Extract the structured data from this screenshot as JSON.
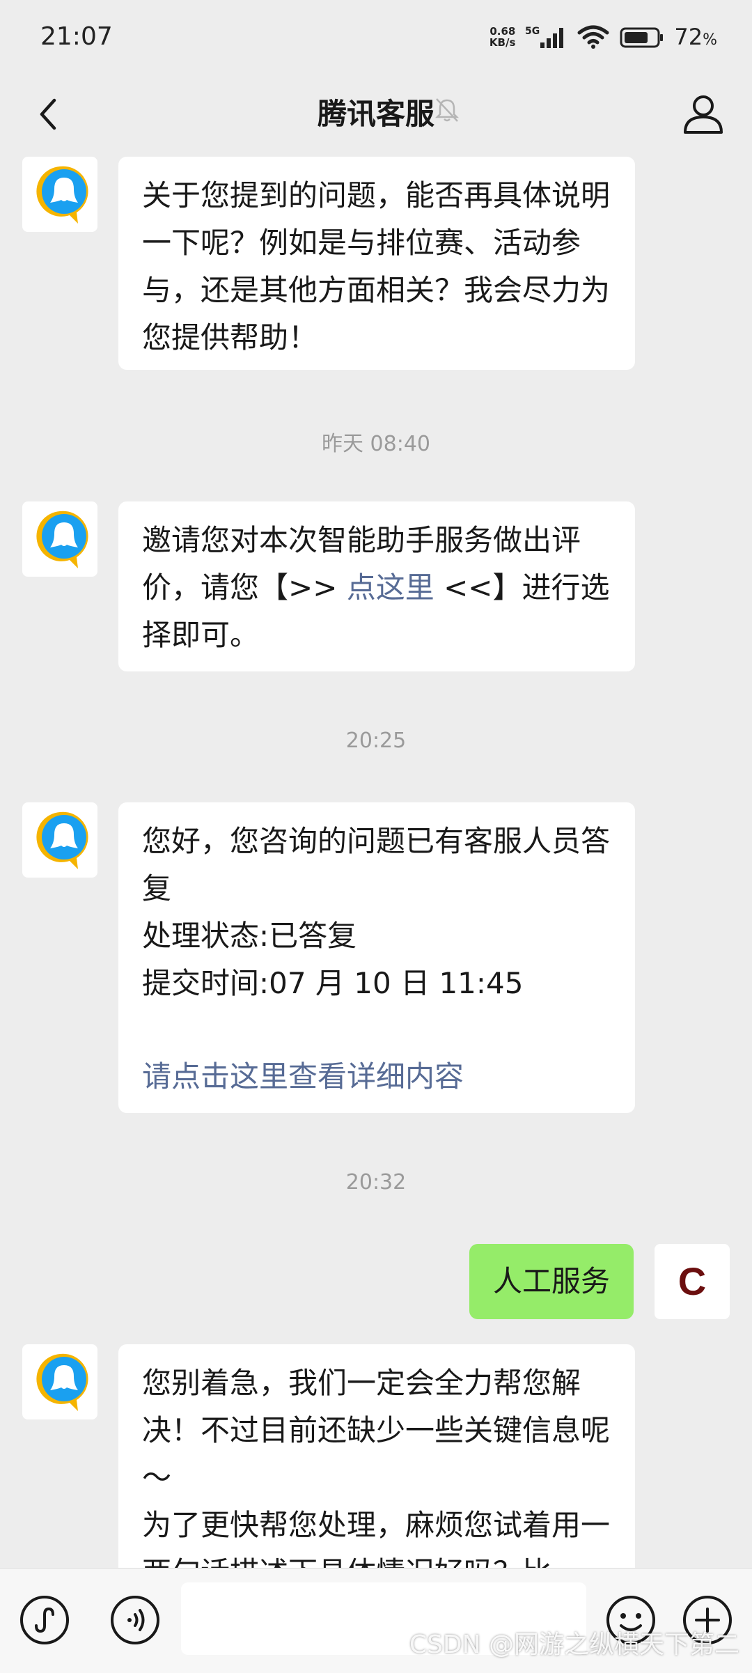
{
  "status_bar": {
    "time": "21:07",
    "net_speed_top": "0.68",
    "net_speed_bottom": "KB/s",
    "network_type": "5G",
    "battery": "72",
    "battery_unit": "%"
  },
  "nav": {
    "title": "腾讯客服"
  },
  "messages": [
    {
      "type": "incoming",
      "text": "关于您提到的问题，能否再具体说明一下呢？例如是与排位赛、活动参与，还是其他方面相关？我会尽力为您提供帮助！"
    },
    {
      "type": "timestamp",
      "text": "昨天 08:40"
    },
    {
      "type": "incoming",
      "text_before": "邀请您对本次智能助手服务做出评价，请您【>> ",
      "link": "点这里",
      "text_after": " <<】进行选择即可。"
    },
    {
      "type": "timestamp",
      "text": "20:25"
    },
    {
      "type": "incoming",
      "line1": "您好，您咨询的问题已有客服人员答复",
      "line2": "处理状态:已答复",
      "line3": "提交时间:07 月 10 日 11:45",
      "link": "请点击这里查看详细内容"
    },
    {
      "type": "timestamp",
      "text": "20:32"
    },
    {
      "type": "outgoing",
      "text": "人工服务",
      "avatar_text": "C"
    },
    {
      "type": "incoming",
      "line1": "您别着急，我们一定会全力帮您解决！不过目前还缺少一些关键信息呢～",
      "line2": "为了更快帮您处理，麻烦您试着用一两句话描述下具体情况好吗？比"
    }
  ],
  "watermark": "CSDN @网游之纵横天下第二",
  "colors": {
    "background": "#ededed",
    "outgoing_bubble": "#95ec69",
    "link": "#576b95"
  }
}
